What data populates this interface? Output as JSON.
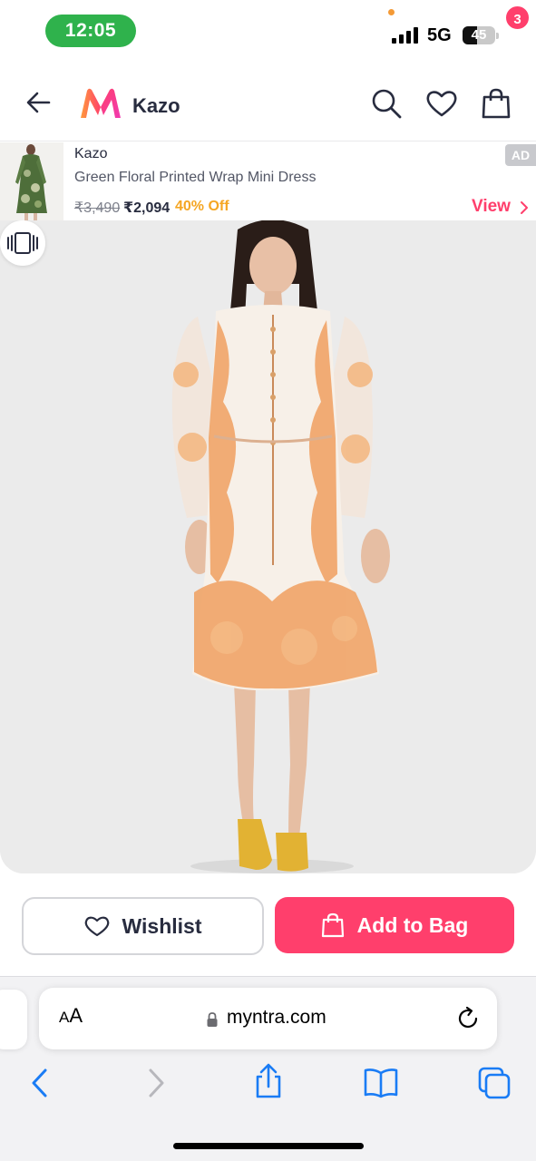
{
  "status_bar": {
    "time": "12:05",
    "network": "5G",
    "battery_level": "45"
  },
  "header": {
    "brand_name": "Kazo",
    "cart_count": "3",
    "icons": [
      "back-arrow-icon",
      "myntra-logo",
      "search-icon",
      "heart-icon",
      "bag-icon"
    ]
  },
  "ad": {
    "brand": "Kazo",
    "title": "Green Floral Printed Wrap Mini Dress",
    "mrp": "₹3,490",
    "price": "₹2,094",
    "discount": "40% Off",
    "badge": "AD",
    "view_label": "View"
  },
  "actions": {
    "wishlist_label": "Wishlist",
    "add_to_bag_label": "Add to Bag"
  },
  "browser": {
    "text_size_label_small": "A",
    "text_size_label_large": "A",
    "url": "myntra.com",
    "toolbar_icons": [
      "back-icon",
      "forward-icon",
      "share-icon",
      "bookmarks-icon",
      "tabs-icon"
    ]
  },
  "colors": {
    "accent": "#ff3f6c",
    "discount": "#f5a623",
    "time_pill": "#2fb24c",
    "browser_blue": "#1a7cf5"
  }
}
